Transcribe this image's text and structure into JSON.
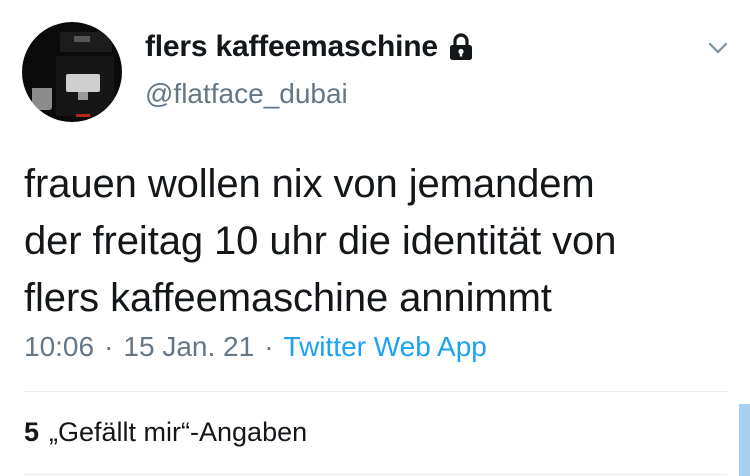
{
  "user": {
    "display_name": "flers kaffeemaschine",
    "handle": "@flatface_dubai",
    "protected_icon": "lock-icon",
    "avatar_icon": "coffee-machine-avatar"
  },
  "menu": {
    "icon": "chevron-down-icon"
  },
  "tweet": {
    "text": "frauen wollen nix von jemandem\nder freitag 10 uhr die identität von\nflers kaffeemaschine annimmt"
  },
  "meta": {
    "time": "10:06",
    "separator": "·",
    "date": "15 Jan. 21",
    "source": "Twitter Web App"
  },
  "stats": {
    "likes_count": "5",
    "likes_label": "„Gefällt mir“-Angaben"
  },
  "colors": {
    "text": "#14171a",
    "secondary": "#657786",
    "link": "#1da1f2",
    "divider": "#e6ecf0"
  }
}
